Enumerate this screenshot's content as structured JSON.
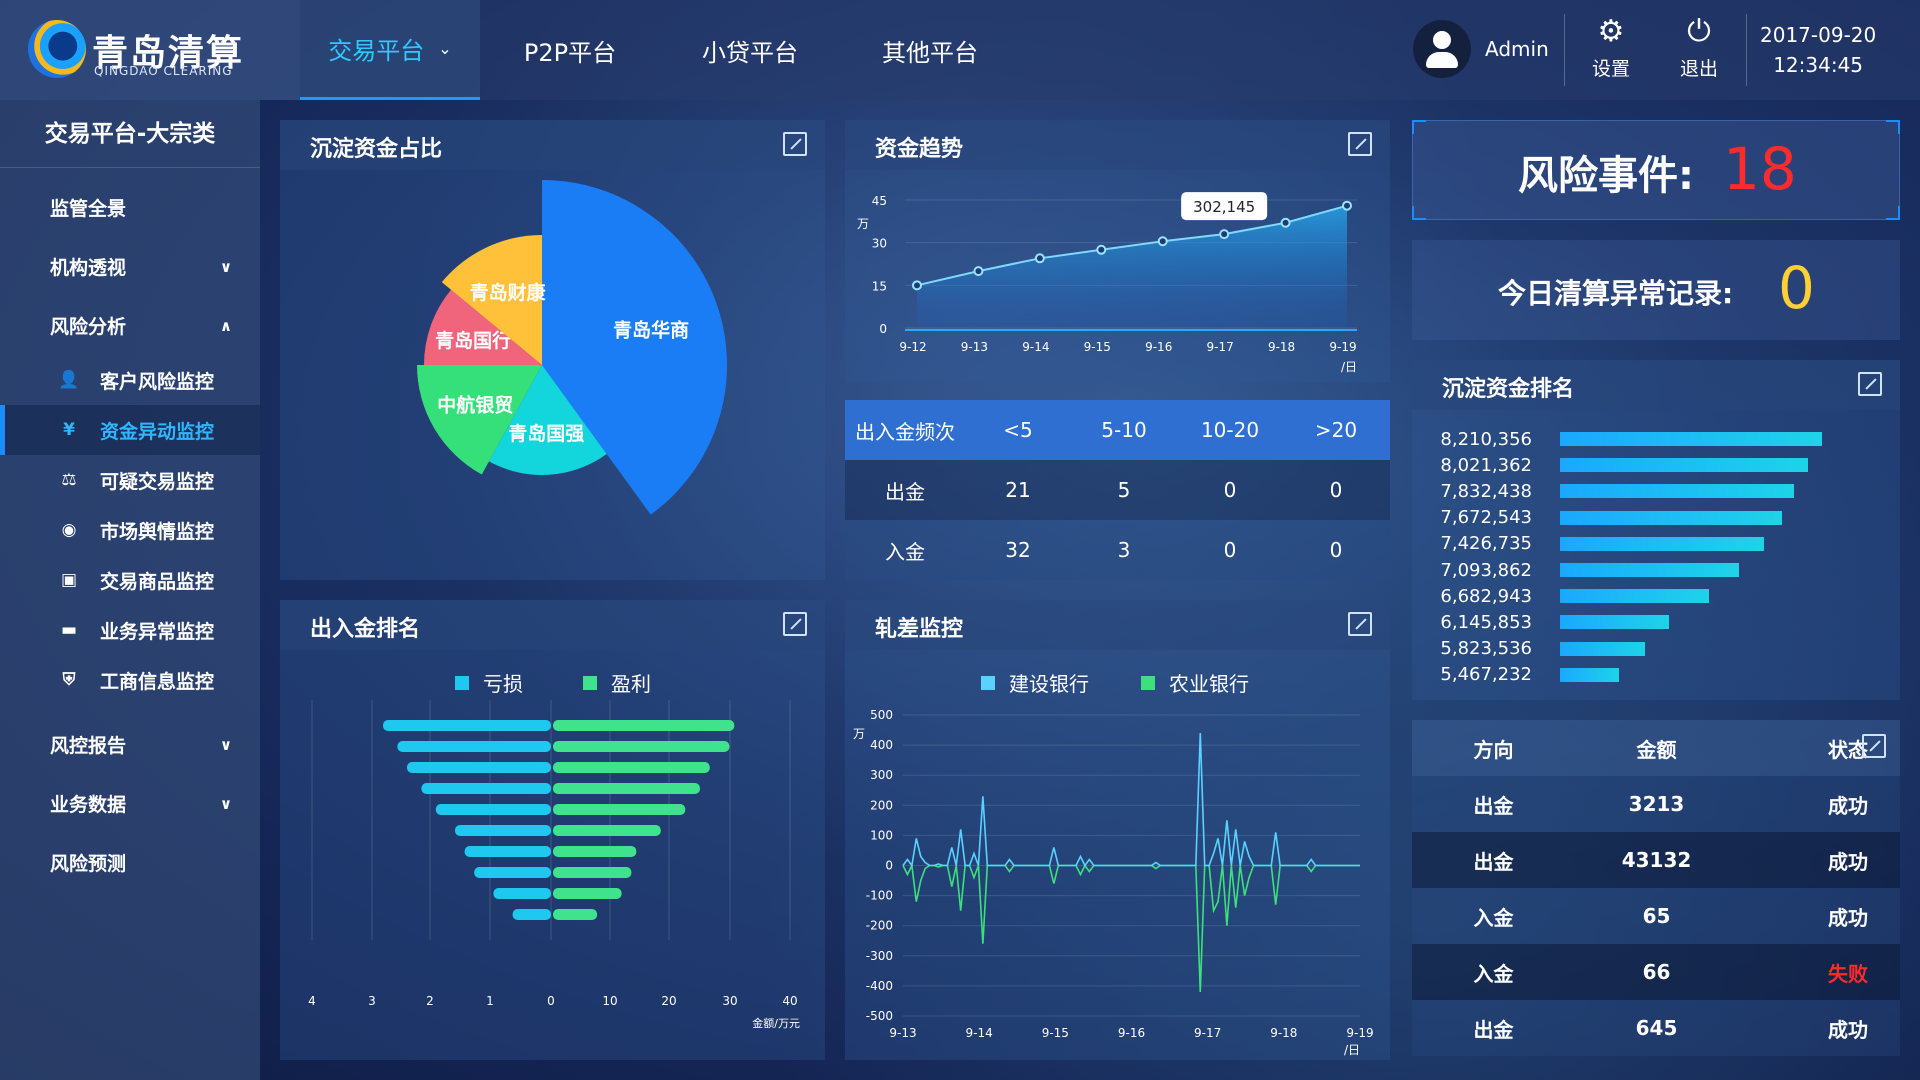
{
  "brand": {
    "name_cn": "青岛清算",
    "name_en": "QINGDAO CLEARING"
  },
  "nav": {
    "tabs": [
      "交易平台",
      "P2P平台",
      "小贷平台",
      "其他平台"
    ]
  },
  "user": {
    "name": "Admin"
  },
  "tools": {
    "settings": "设置",
    "logout": "退出"
  },
  "clock": {
    "date": "2017-09-20",
    "time": "12:34:45"
  },
  "sidebar": {
    "title": "交易平台-大宗类",
    "items": [
      {
        "label": "监管全景"
      },
      {
        "label": "机构透视"
      },
      {
        "label": "风险分析"
      },
      {
        "label": "风控报告"
      },
      {
        "label": "业务数据"
      },
      {
        "label": "风险预测"
      }
    ],
    "subitems": [
      {
        "label": "客户风险监控",
        "icon": "user-icon"
      },
      {
        "label": "资金异动监控",
        "icon": "yen-icon"
      },
      {
        "label": "可疑交易监控",
        "icon": "trade-icon"
      },
      {
        "label": "市场舆情监控",
        "icon": "target-icon"
      },
      {
        "label": "交易商品监控",
        "icon": "bag-icon"
      },
      {
        "label": "业务异常监控",
        "icon": "folder-icon"
      },
      {
        "label": "工商信息监控",
        "icon": "shield-icon"
      }
    ]
  },
  "panels": {
    "pie": {
      "title": "沉淀资金占比"
    },
    "trend": {
      "title": "资金趋势"
    },
    "rank": {
      "title": "出入金排名"
    },
    "net": {
      "title": "轧差监控"
    },
    "settle": {
      "title": "沉淀资金排名"
    }
  },
  "freq": {
    "header": [
      "出入金频次",
      "<5",
      "5-10",
      "10-20",
      ">20"
    ],
    "rows": [
      [
        "出金",
        "21",
        "5",
        "0",
        "0"
      ],
      [
        "入金",
        "32",
        "3",
        "0",
        "0"
      ]
    ]
  },
  "risk": {
    "label": "风险事件:",
    "value": "18"
  },
  "today": {
    "label": "今日清算异常记录:",
    "value": "0"
  },
  "transactions": {
    "header": [
      "方向",
      "金额",
      "状态"
    ],
    "rows": [
      [
        "出金",
        "3213",
        "成功"
      ],
      [
        "出金",
        "43132",
        "成功"
      ],
      [
        "入金",
        "65",
        "成功"
      ],
      [
        "入金",
        "66",
        "失败"
      ],
      [
        "出金",
        "645",
        "成功"
      ]
    ]
  },
  "colors": {
    "fail": "#ff2b2b",
    "success": "#ffffff",
    "loss": "#1ec8ef",
    "profit": "#3fe38e",
    "ccb": "#5ad2ff",
    "abc": "#3ee07e"
  },
  "chart_data": [
    {
      "type": "pie",
      "title": "沉淀资金占比",
      "labels": [
        "青岛华商",
        "青岛国强",
        "中航银贸",
        "青岛国行",
        "青岛财康"
      ],
      "values": [
        40,
        18,
        17,
        11,
        14
      ],
      "colors": [
        "#1a7df5",
        "#12d6dc",
        "#35e07a",
        "#f0647c",
        "#ffc13a"
      ]
    },
    {
      "type": "area",
      "title": "资金趋势",
      "ylabel": "万",
      "xlabel": "日",
      "x": [
        "9-12",
        "9-13",
        "9-14",
        "9-15",
        "9-16",
        "9-17",
        "9-18",
        "9-19"
      ],
      "values": [
        15,
        20,
        24.5,
        27.5,
        30.5,
        33,
        37,
        43
      ],
      "ylim": [
        0,
        45
      ],
      "yticks": [
        0,
        15,
        30,
        45
      ],
      "annotation": "302,145",
      "annotation_index": 5
    },
    {
      "type": "bar",
      "title": "出入金排名",
      "legend": [
        "亏损",
        "盈利"
      ],
      "xlabel": "金额/万元",
      "left_ticks": [
        "4",
        "3",
        "2",
        "1",
        "0"
      ],
      "right_ticks": [
        "10",
        "20",
        "30",
        "40"
      ],
      "loss": [
        3.5,
        3.2,
        3.0,
        2.7,
        2.4,
        2.0,
        1.8,
        1.6,
        1.2,
        0.8
      ],
      "profit": [
        37,
        36,
        32,
        30,
        27,
        22,
        17,
        16,
        14,
        9
      ]
    },
    {
      "type": "line",
      "title": "轧差监控",
      "legend": [
        "建设银行",
        "农业银行"
      ],
      "ylabel": "万",
      "xlabel": "日",
      "x": [
        "9-13",
        "9-14",
        "9-15",
        "9-16",
        "9-17",
        "9-18",
        "9-19"
      ],
      "ylim": [
        -500,
        500
      ],
      "yticks": [
        500,
        400,
        300,
        200,
        100,
        0,
        -100,
        -200,
        -300,
        -400,
        -500
      ],
      "ccb": [
        0,
        20,
        0,
        90,
        30,
        10,
        0,
        0,
        5,
        0,
        0,
        60,
        0,
        120,
        0,
        0,
        40,
        0,
        230,
        0,
        0,
        0,
        0,
        0,
        20,
        0,
        0,
        0,
        0,
        0,
        0,
        0,
        0,
        0,
        60,
        0,
        0,
        0,
        0,
        0,
        30,
        0,
        20,
        0,
        0,
        0,
        0,
        0,
        0,
        0,
        0,
        0,
        0,
        0,
        0,
        0,
        0,
        10,
        0,
        0,
        0,
        0,
        0,
        0,
        0,
        0,
        0,
        440,
        0,
        0,
        40,
        90,
        0,
        150,
        0,
        120,
        0,
        80,
        30,
        0,
        0,
        0,
        0,
        0,
        110,
        0,
        0,
        0,
        0,
        0,
        0,
        0,
        20,
        0,
        0,
        0,
        0,
        0,
        0,
        0,
        0,
        0,
        0,
        0
      ],
      "abc": [
        0,
        -30,
        0,
        -120,
        -50,
        -10,
        0,
        0,
        -5,
        0,
        0,
        -70,
        0,
        -150,
        0,
        0,
        -40,
        0,
        -260,
        0,
        0,
        0,
        0,
        0,
        -20,
        0,
        0,
        0,
        0,
        0,
        0,
        0,
        0,
        0,
        -60,
        0,
        0,
        0,
        0,
        0,
        -30,
        0,
        -20,
        0,
        0,
        0,
        0,
        0,
        0,
        0,
        0,
        0,
        0,
        0,
        0,
        0,
        0,
        -10,
        0,
        0,
        0,
        0,
        0,
        0,
        0,
        0,
        0,
        -420,
        0,
        0,
        -150,
        -120,
        0,
        -200,
        0,
        -140,
        0,
        -100,
        -40,
        0,
        0,
        0,
        0,
        0,
        -130,
        0,
        0,
        0,
        0,
        0,
        0,
        0,
        -20,
        0,
        0,
        0,
        0,
        0,
        0,
        0,
        0,
        0,
        0,
        0
      ]
    },
    {
      "type": "bar",
      "title": "沉淀资金排名",
      "values": [
        8210356,
        8021362,
        7832438,
        7672543,
        7426735,
        7093862,
        6682943,
        6145853,
        5823536,
        5467232
      ],
      "labels": [
        "8,210,356",
        "8,021,362",
        "7,832,438",
        "7,672,543",
        "7,426,735",
        "7,093,862",
        "6,682,943",
        "6,145,853",
        "5,823,536",
        "5,467,232"
      ]
    }
  ]
}
